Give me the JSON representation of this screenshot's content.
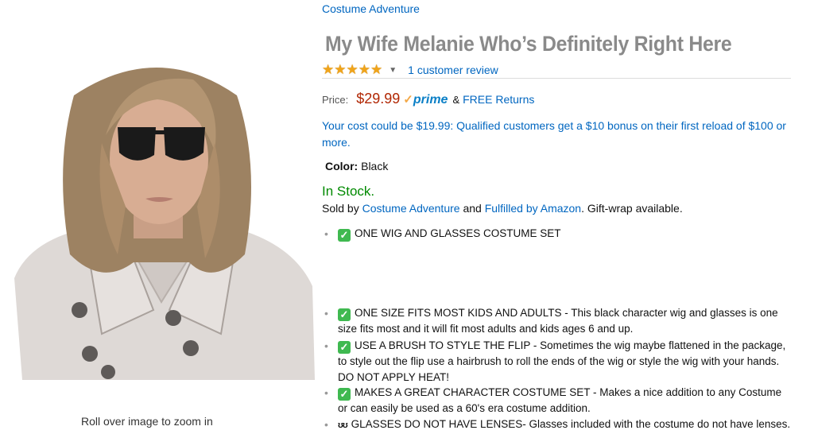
{
  "brand": "Costume Adventure",
  "title": "My Wife Melanie Who’s Definitely Right Here",
  "rating": {
    "stars": 5,
    "max": 5,
    "review_count_text": "1 customer review"
  },
  "price": {
    "label": "Price:",
    "value": "$29.99",
    "prime_label": "prime",
    "amp": "&",
    "free_returns": "FREE Returns"
  },
  "promo_text": "Your cost could be $19.99: Qualified customers get a $10 bonus on their first reload of $100 or more.",
  "color": {
    "label": "Color:",
    "value": "Black"
  },
  "stock": "In Stock.",
  "sold_by": {
    "prefix": "Sold by",
    "seller": "Costume Adventure",
    "middle": "and",
    "fulfiller": "Fulfilled by Amazon",
    "suffix": ". Gift-wrap available."
  },
  "bullets": [
    {
      "icon": "check-icon",
      "text": "ONE WIG AND GLASSES COSTUME SET"
    },
    {
      "icon": "check-icon",
      "text": "ONE SIZE FITS MOST KIDS AND ADULTS - This black character wig and glasses is one size fits most and it will fit most adults and kids ages 6 and up."
    },
    {
      "icon": "check-icon",
      "text": "USE A BRUSH TO STYLE THE FLIP - Sometimes the wig maybe flattened in the package, to style out the flip use a hairbrush to roll the ends of the wig or style the wig with your hands. DO NOT APPLY HEAT!"
    },
    {
      "icon": "check-icon",
      "text": "MAKES A GREAT CHARACTER COSTUME SET - Makes a nice addition to any Costume or can easily be used as a 60's era costume addition."
    },
    {
      "icon": "glasses-icon",
      "text": "GLASSES DO NOT HAVE LENSES- Glasses included with the costume do not have lenses."
    }
  ],
  "zoom_hint": "Roll over image to zoom in",
  "colors": {
    "link": "#0066c0",
    "price": "#b12704",
    "stock": "#008a00",
    "star": "#f0a41a",
    "title": "#8a8a8a"
  }
}
